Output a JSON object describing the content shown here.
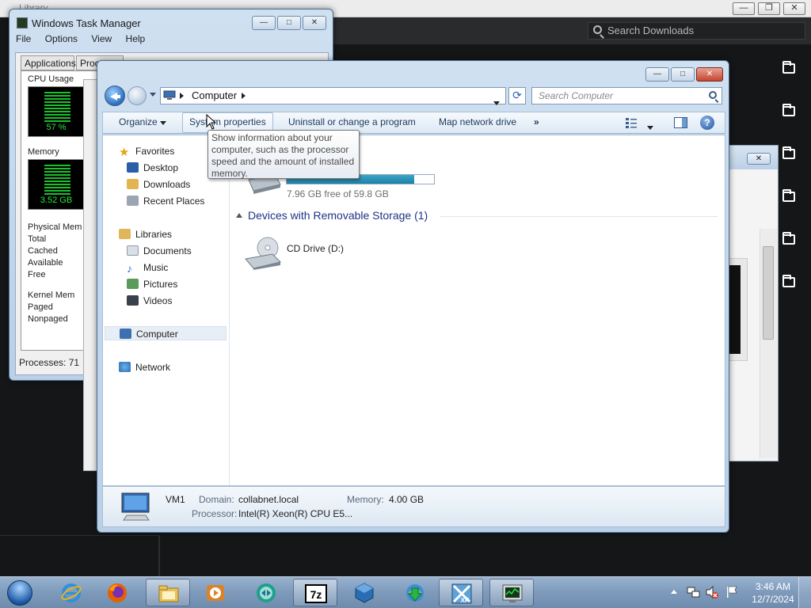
{
  "background_app": {
    "title": "Library",
    "search_placeholder": "Search Downloads",
    "folder_icons": [
      "folder-icon",
      "folder-icon",
      "folder-icon",
      "folder-icon",
      "folder-icon",
      "folder-icon"
    ]
  },
  "task_manager": {
    "title": "Windows Task Manager",
    "menu": [
      "File",
      "Options",
      "View",
      "Help"
    ],
    "tabs": [
      "Applications",
      "Proce"
    ],
    "cpu_label": "CPU Usage",
    "cpu_value": "57 %",
    "memory_label": "Memory",
    "memory_value": "3.52 GB",
    "physical_memory": [
      "Physical Mem",
      "Total",
      "Cached",
      "Available",
      "Free"
    ],
    "kernel_memory": [
      "Kernel Mem",
      "Paged",
      "Nonpaged"
    ],
    "status": "Processes: 71"
  },
  "explorer": {
    "address": {
      "crumb": "Computer"
    },
    "search_placeholder": "Search Computer",
    "commands": {
      "organize": "Organize",
      "system_properties": "System properties",
      "uninstall": "Uninstall or change a program",
      "map_drive": "Map network drive",
      "more": "»"
    },
    "nav": {
      "favorites": "Favorites",
      "desktop": "Desktop",
      "downloads": "Downloads",
      "recent_places": "Recent Places",
      "libraries": "Libraries",
      "documents": "Documents",
      "music": "Music",
      "pictures": "Pictures",
      "videos": "Videos",
      "computer": "Computer",
      "network": "Network"
    },
    "drive": {
      "free_text": "7.96 GB free of 59.8 GB",
      "used_fraction": 0.867
    },
    "removable_group": "Devices with Removable Storage (1)",
    "cd_drive": "CD Drive (D:)",
    "tooltip": "Show information about your computer, such as the processor speed and the amount of installed memory.",
    "details": {
      "name": "VM1",
      "domain_label": "Domain:",
      "domain_value": "collabnet.local",
      "memory_label": "Memory:",
      "memory_value": "4.00 GB",
      "processor_label": "Processor:",
      "processor_value": "Intel(R) Xeon(R) CPU E5..."
    }
  },
  "taskbar": {
    "pinned": [
      "internet-explorer-icon",
      "firefox-icon",
      "file-explorer-icon",
      "media-player-icon",
      "teamviewer-icon",
      "7zip-icon",
      "virtualbox-icon",
      "download-manager-icon",
      "xp-mode-icon",
      "task-manager-icon"
    ],
    "tray_icons": [
      "show-hidden-icons",
      "network-icon",
      "volume-muted-icon",
      "action-center-flag-icon"
    ],
    "clock_time": "3:46 AM",
    "clock_date": "12/7/2024"
  },
  "colors": {
    "accent": "#1e3287",
    "drive_fill": "#2a90b8",
    "meter_green": "#27e63b",
    "taskbar": "#7e9abb"
  }
}
